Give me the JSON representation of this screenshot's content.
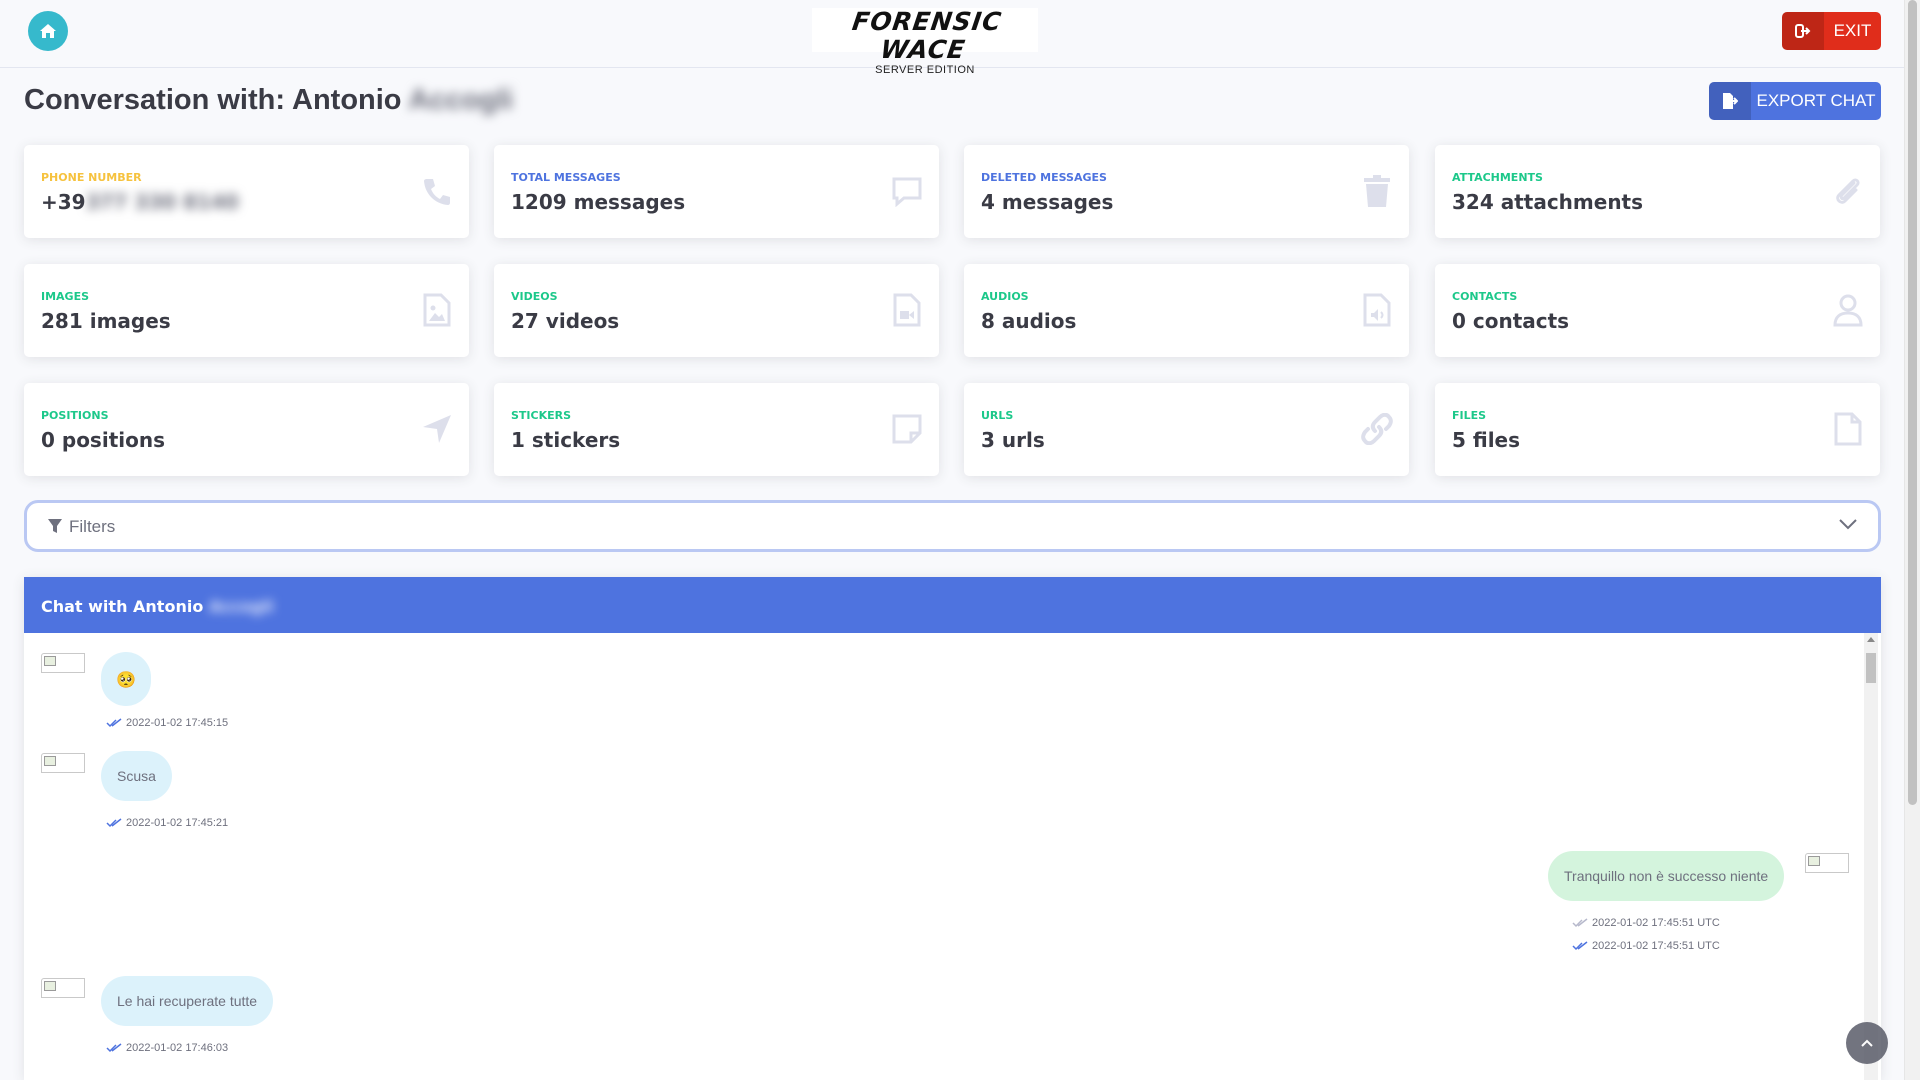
{
  "app": {
    "logo_main": "FORENSIC WACE",
    "logo_sub": "SERVER EDITION",
    "exit_label": "EXIT"
  },
  "heading": {
    "prefix": "Conversation with:",
    "first_name": "Antonio",
    "last_name": "Accogli"
  },
  "export_label": "EXPORT CHAT",
  "stats": {
    "phone": {
      "title": "PHONE NUMBER",
      "value_prefix": "+39",
      "value_hidden": "377 330 8140"
    },
    "total_messages": {
      "title": "TOTAL MESSAGES",
      "value": "1209 messages"
    },
    "deleted_messages": {
      "title": "DELETED MESSAGES",
      "value": "4 messages"
    },
    "attachments": {
      "title": "ATTACHMENTS",
      "value": "324 attachments"
    },
    "images": {
      "title": "IMAGES",
      "value": "281 images"
    },
    "videos": {
      "title": "VIDEOS",
      "value": "27 videos"
    },
    "audios": {
      "title": "AUDIOS",
      "value": "8 audios"
    },
    "contacts": {
      "title": "CONTACTS",
      "value": "0 contacts"
    },
    "positions": {
      "title": "POSITIONS",
      "value": "0 positions"
    },
    "stickers": {
      "title": "STICKERS",
      "value": "1 stickers"
    },
    "urls": {
      "title": "URLS",
      "value": "3 urls"
    },
    "files": {
      "title": "FILES",
      "value": "5 files"
    }
  },
  "filters_label": "Filters",
  "chat": {
    "header_prefix": "Chat with Antonio",
    "header_hidden": "Accogli",
    "messages": [
      {
        "text": "🥺",
        "time": "2022-01-02 17:45:15"
      },
      {
        "text": "Scusa",
        "time": "2022-01-02 17:45:21"
      },
      {
        "text": "Tranquillo non è successo niente",
        "time1": "2022-01-02 17:45:51 UTC",
        "time2": "2022-01-02 17:45:51 UTC"
      },
      {
        "text": "Le hai recuperate tutte",
        "time": "2022-01-02 17:46:03"
      }
    ]
  },
  "colors": {
    "primary": "#4e73df",
    "info": "#36b9cc",
    "danger": "#e02d1b",
    "warning": "#f6c23e",
    "success": "#1cc88a"
  }
}
